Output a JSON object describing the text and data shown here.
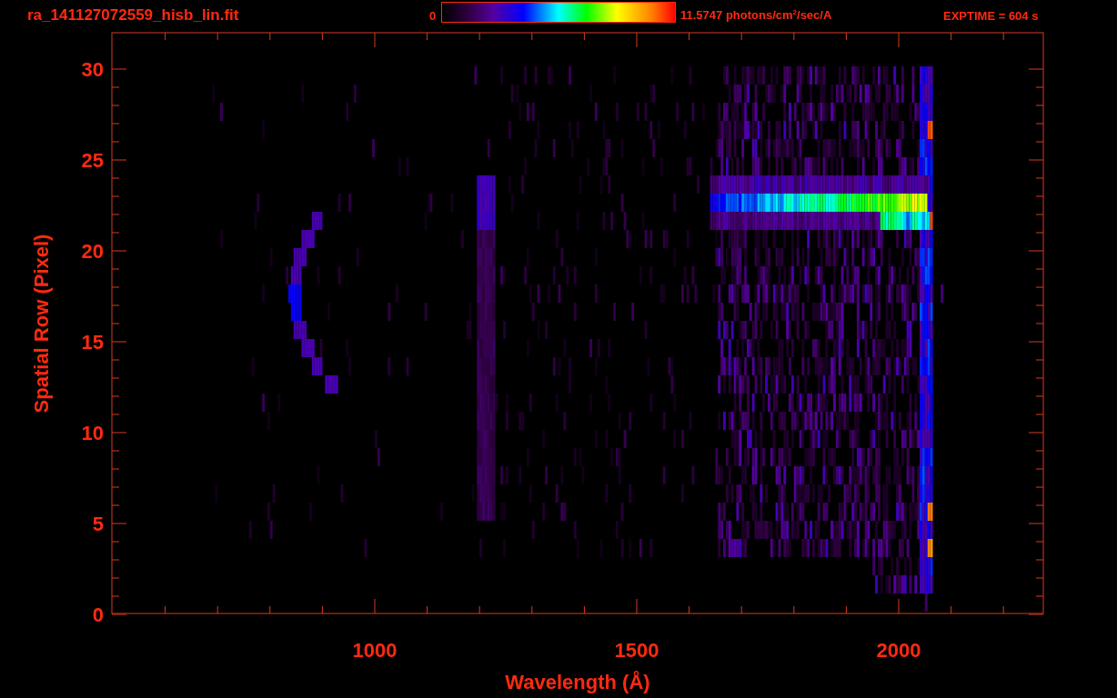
{
  "header": {
    "title": "ra_141127072559_hisb_lin.fit",
    "colorbar": {
      "min_label": "0",
      "max_label": "11.5747 photons/cm$^{2}$/sec/A"
    },
    "exposure": "EXPTIME = 604 s"
  },
  "plot": {
    "x_axis": {
      "label": "Wavelength (Å)",
      "ticks": [
        "1000",
        "1500",
        "2000"
      ]
    },
    "y_axis": {
      "label": "Spatial Row (Pixel)",
      "ticks": [
        "30",
        "25",
        "20",
        "15",
        "10",
        "5",
        "0"
      ]
    }
  }
}
